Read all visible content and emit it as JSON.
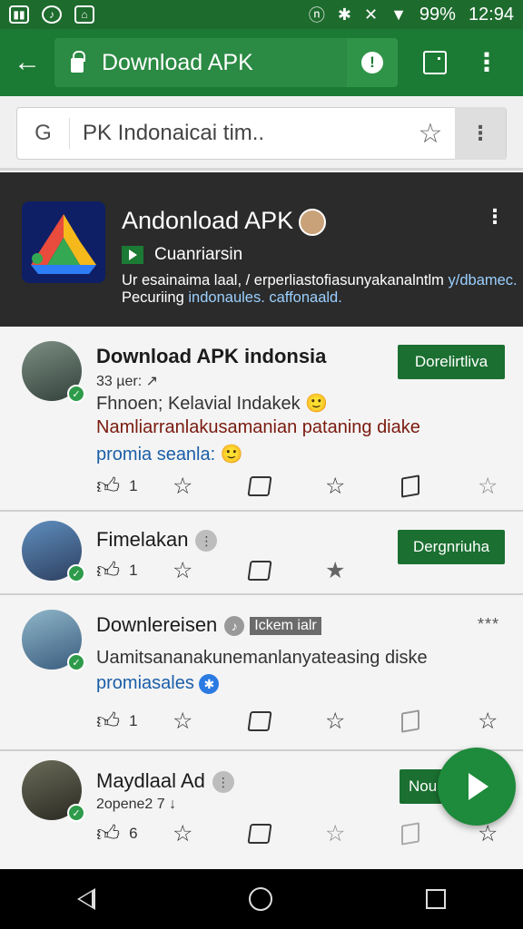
{
  "status_bar": {
    "left_icons": [
      "image-icon",
      "music-icon",
      "photo-icon"
    ],
    "battery": "99%",
    "time": "12:94"
  },
  "toolbar": {
    "url_title": "Download APK"
  },
  "search": {
    "query": "PK Indonaicai tim.."
  },
  "hero": {
    "title": "Andonload APK",
    "subtitle": "Cuanriarsin",
    "desc_line1_prefix": "Ur esainaima laal, / erperliastofiasunyakanalntlm",
    "desc_line1_link": "y/dbamec.",
    "desc_line2_prefix": "Pecuriing",
    "desc_line2_link": "indonaules. caffonaald."
  },
  "posts": [
    {
      "name": "Download APK indonsia",
      "meta": "33 µer: ↗",
      "button": "Dorelirtliva",
      "line1": "Fhnoen; Kelavial Indakek 🙂",
      "line2": "Namliarranlakusamanian pataning diake",
      "line3": "promia seanla: 🙂",
      "likes": "1"
    },
    {
      "name": "Fimelakan",
      "button": "Dergnriuha",
      "likes": "1"
    },
    {
      "name": "Downlereisen",
      "tag": "Ickem ialr",
      "more": "***",
      "line1": "Uamitsananakunemanlanyateasing diske",
      "line3": "promiasales",
      "likes": "1"
    },
    {
      "name": "Maydlaal Ad",
      "meta": "2opene2   7 ↓",
      "button": "Nou",
      "likes": "6"
    }
  ],
  "colors": {
    "brand_green": "#1b7a33",
    "dark_hero": "#2b2b2b",
    "link_blue": "#1b5ea8"
  }
}
